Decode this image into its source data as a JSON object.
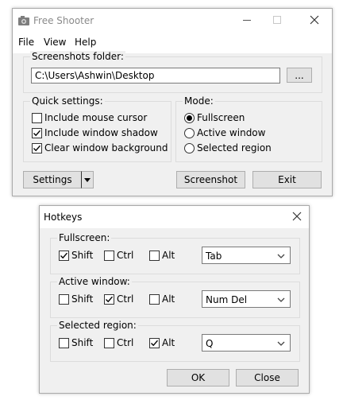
{
  "main_window": {
    "title": "Free Shooter",
    "menu": [
      "File",
      "View",
      "Help"
    ],
    "folder_group_label": "Screenshots folder:",
    "folder_value": "C:\\Users\\Ashwin\\Desktop",
    "browse_label": "...",
    "quick_settings": {
      "label": "Quick settings:",
      "options": [
        {
          "label": "Include mouse cursor",
          "checked": false
        },
        {
          "label": "Include window shadow",
          "checked": true
        },
        {
          "label": "Clear window background",
          "checked": true
        }
      ]
    },
    "mode": {
      "label": "Mode:",
      "options": [
        {
          "label": "Fullscreen",
          "selected": true
        },
        {
          "label": "Active window",
          "selected": false
        },
        {
          "label": "Selected region",
          "selected": false
        }
      ]
    },
    "settings_label": "Settings",
    "screenshot_label": "Screenshot",
    "exit_label": "Exit"
  },
  "hotkeys_dialog": {
    "title": "Hotkeys",
    "groups": [
      {
        "label": "Fullscreen:",
        "shift": true,
        "ctrl": false,
        "alt": false,
        "key": "Tab"
      },
      {
        "label": "Active window:",
        "shift": false,
        "ctrl": true,
        "alt": false,
        "key": "Num Del"
      },
      {
        "label": "Selected region:",
        "shift": false,
        "ctrl": false,
        "alt": true,
        "key": "Q"
      }
    ],
    "modifier_labels": {
      "shift": "Shift",
      "ctrl": "Ctrl",
      "alt": "Alt"
    },
    "ok_label": "OK",
    "close_label": "Close"
  }
}
